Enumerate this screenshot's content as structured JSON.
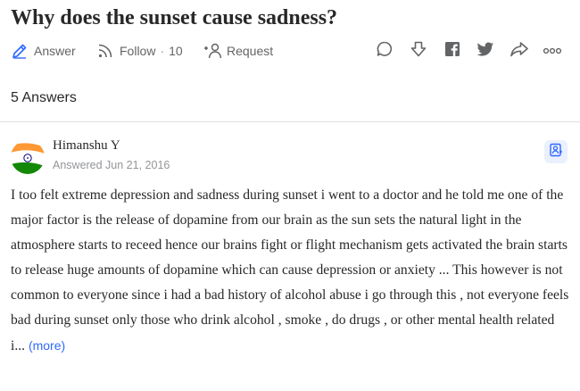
{
  "question": {
    "title": "Why does the sunset cause sadness?"
  },
  "actions": {
    "answer_label": "Answer",
    "follow_label": "Follow",
    "follow_dot": "·",
    "follow_count": "10",
    "request_label": "Request"
  },
  "answers_header": "5 Answers",
  "answer": {
    "author": "Himanshu Y",
    "meta": "Answered Jun 21, 2016",
    "text": "I too felt extreme depression and sadness during sunset i went to a doctor and he told me one of the major factor is the release of dopamine from our brain as the sun sets the natural light in the atmosphere starts to receed hence our brains fight or flight mechanism gets activated the brain starts to release huge amounts of dopamine which can cause depression or anxiety ... This however is not common to everyone since i had a bad history of alcohol abuse i go through this , not everyone feels bad during sunset only those who drink alcohol , smoke , do drugs , or other mental health related i...",
    "more_label": "(more)"
  },
  "icons": {
    "answer": "pencil-icon",
    "follow": "rss-icon",
    "request": "person-plus-icon",
    "comment": "speech-bubble-icon",
    "downvote": "down-arrow-icon",
    "facebook": "facebook-icon",
    "twitter": "twitter-icon",
    "share": "share-arrow-icon",
    "more": "ellipsis-icon",
    "bookmark": "bookmark-person-icon",
    "avatar": "india-flag-avatar"
  },
  "colors": {
    "text": "#282829",
    "muted": "#636466",
    "meta": "#939598",
    "link": "#2e69ff",
    "answer_icon": "#2e69ff",
    "flag_saffron": "#ff9933",
    "flag_green": "#138808",
    "flag_chakra": "#000080"
  }
}
